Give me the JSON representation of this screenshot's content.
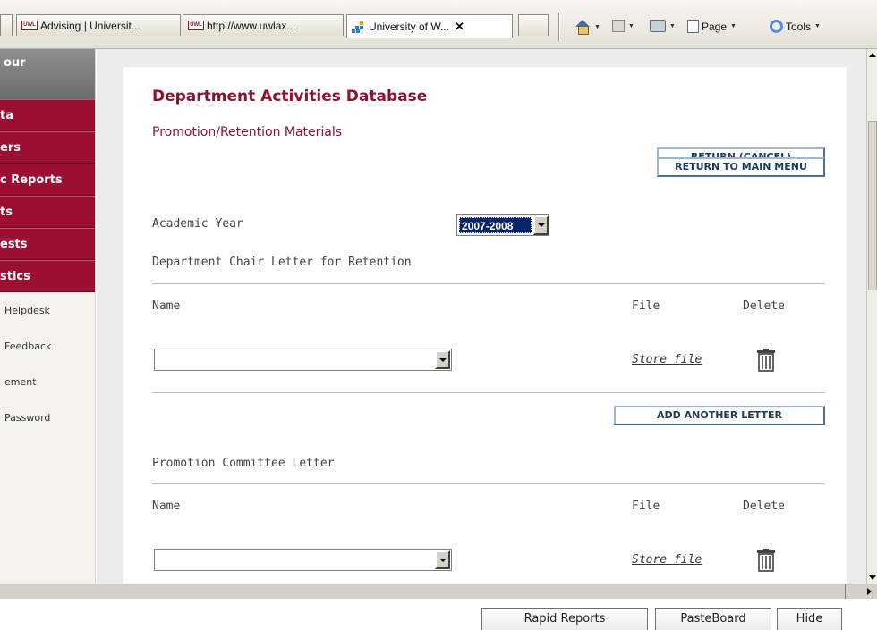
{
  "browser": {
    "tabs": [
      {
        "favicon": "UWL",
        "label": "Advising | Universit..."
      },
      {
        "favicon": "UWL",
        "label": "http://www.uwlax...."
      },
      {
        "favicon": "",
        "label": "University of W...",
        "close": "✕"
      }
    ],
    "commands": {
      "page": "Page",
      "tools": "Tools"
    },
    "icons": [
      "home-icon",
      "rss-feed-icon",
      "print-icon",
      "page-icon",
      "tools-gear-icon"
    ]
  },
  "sidebar": {
    "header": "our",
    "red_items": [
      "ta",
      "ers",
      "c Reports",
      "ts",
      "ests",
      "stics"
    ],
    "links": [
      "Helpdesk",
      "Feedback",
      "ement",
      "Password"
    ]
  },
  "main": {
    "title": "Department Activities Database",
    "subtitle": "Promotion/Retention Materials",
    "return_cancel": "RETURN (CANCEL)",
    "return_main": "RETURN TO MAIN MENU",
    "academic_year_label": "Academic Year",
    "academic_year_value": "2007-2008",
    "section1": {
      "heading": "Department Chair Letter for Retention",
      "col_name": "Name",
      "col_file": "File",
      "col_delete": "Delete",
      "store_file": "Store file",
      "name_value": ""
    },
    "add_letter": "ADD ANOTHER LETTER",
    "section2": {
      "heading": "Promotion Committee Letter",
      "col_name": "Name",
      "col_file": "File",
      "col_delete": "Delete",
      "store_file": "Store file",
      "name_value": ""
    }
  },
  "bottom_bar": {
    "rapid_reports": "Rapid Reports",
    "pasteboard": "PasteBoard",
    "hide": "Hide"
  },
  "colors": {
    "accent": "#9b0f33",
    "title": "#8c1230",
    "button_border": "#4e6f91"
  }
}
